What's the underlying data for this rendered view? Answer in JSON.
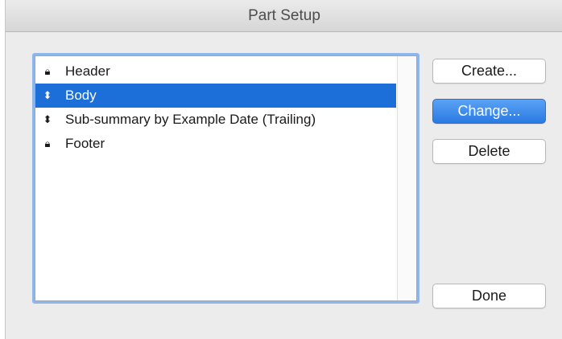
{
  "window": {
    "title": "Part Setup"
  },
  "parts_list": {
    "items": [
      {
        "label": "Header",
        "icon": "lock-icon",
        "glyph": "🔒︎",
        "selected": false
      },
      {
        "label": "Body",
        "icon": "reorder-arrows-icon",
        "glyph": "⬍",
        "selected": true
      },
      {
        "label": "Sub-summary by Example Date (Trailing)",
        "icon": "reorder-arrows-icon",
        "glyph": "⬍",
        "selected": false
      },
      {
        "label": "Footer",
        "icon": "lock-icon",
        "glyph": "🔒︎",
        "selected": false
      }
    ]
  },
  "buttons": {
    "create": "Create...",
    "change": "Change...",
    "delete": "Delete",
    "done": "Done"
  },
  "colors": {
    "selection": "#1c6ed8",
    "focus_ring": "#8fb6ea",
    "primary_button": "#2a7ae2",
    "window_bg": "#ececec"
  }
}
